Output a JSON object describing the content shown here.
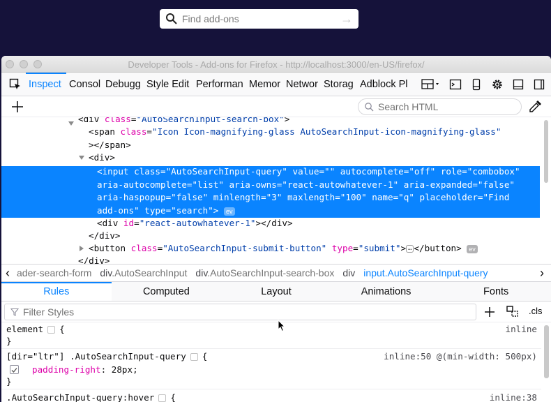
{
  "page": {
    "search_placeholder": "Find add-ons"
  },
  "window": {
    "title": "Developer Tools - Add-ons for Firefox - http://localhost:3000/en-US/firefox/"
  },
  "toolbar": {
    "tabs": [
      "Inspector",
      "Console",
      "Debugger",
      "Style Editor",
      "Performance",
      "Memory",
      "Network",
      "Storage",
      "Adblock Plus"
    ],
    "tab_display": [
      "Inspect",
      "Consol",
      "Debugg",
      "Style Edit",
      "Performan",
      "Memor",
      "Networ",
      "Storag",
      "Adblock Pl"
    ],
    "active_tab": "Inspector"
  },
  "markup": {
    "search_placeholder": "Search HTML",
    "lines": {
      "l1_tag": "<div ",
      "l1_attr": "class",
      "l1_val": "\"AutoSearchInput-search-box\"",
      "l1_end": ">",
      "l2_tag": "<span ",
      "l2_attr": "class",
      "l2_val": "\"Icon Icon-magnifying-glass AutoSearchInput-icon-magnifying-glass\"",
      "l3": "></span>",
      "l4": "<div>",
      "sel1_a": "<input ",
      "sel1_b": "class=\"AutoSearchInput-query\" value=\"\" autocomplete=\"off\" role=\"combobox\"",
      "sel2": "aria-autocomplete=\"list\" aria-owns=\"react-autowhatever-1\" aria-expanded=\"false\"",
      "sel3": "aria-haspopup=\"false\" minlength=\"3\" maxlength=\"100\" name=\"q\" placeholder=\"Find",
      "sel4": "add-ons\" type=\"search\">",
      "ev_badge": "ev",
      "l5_tag": "<div ",
      "l5_attr": "id",
      "l5_val": "\"react-autowhatever-1\"",
      "l5_end": "></div>",
      "l6": "</div>",
      "l7_tag": "<button ",
      "l7_attr1": "class",
      "l7_val1": "\"AutoSearchInput-submit-button\"",
      "l7_attr2": "type",
      "l7_val2": "\"submit\"",
      "l7_mid": ">",
      "l7_ellipsis": "…",
      "l7_end": "</button>",
      "l8": "</div>"
    }
  },
  "breadcrumbs": {
    "items": [
      {
        "prefix": "",
        "text": "ader-search-form"
      },
      {
        "prefix": "div",
        "text": ".AutoSearchInput"
      },
      {
        "prefix": "div",
        "text": ".AutoSearchInput-search-box"
      },
      {
        "prefix": "div",
        "text": ""
      },
      {
        "prefix": "input",
        "text": ".AutoSearchInput-query"
      }
    ]
  },
  "panel_tabs": [
    "Rules",
    "Computed",
    "Layout",
    "Animations",
    "Fonts"
  ],
  "active_panel_tab": "Rules",
  "rules": {
    "filter_placeholder": "Filter Styles",
    "cls_label": ".cls",
    "r1_selector": "element",
    "r1_open": "{",
    "r1_close": "}",
    "r1_source": "inline",
    "r2_selector": "[dir=\"ltr\"] .AutoSearchInput-query",
    "r2_open": "{",
    "r2_source": "inline:50 @(min-width: 500px)",
    "r2_prop": "padding-right",
    "r2_value": "28px;",
    "r2_close": "}",
    "r3_selector": ".AutoSearchInput-query:hover",
    "r3_open": "{",
    "r3_source": "inline:38"
  },
  "colors": {
    "accent": "#0a84ff",
    "page_bg": "#15123a",
    "attr_name": "#dd00a9",
    "attr_value": "#003eaa"
  }
}
